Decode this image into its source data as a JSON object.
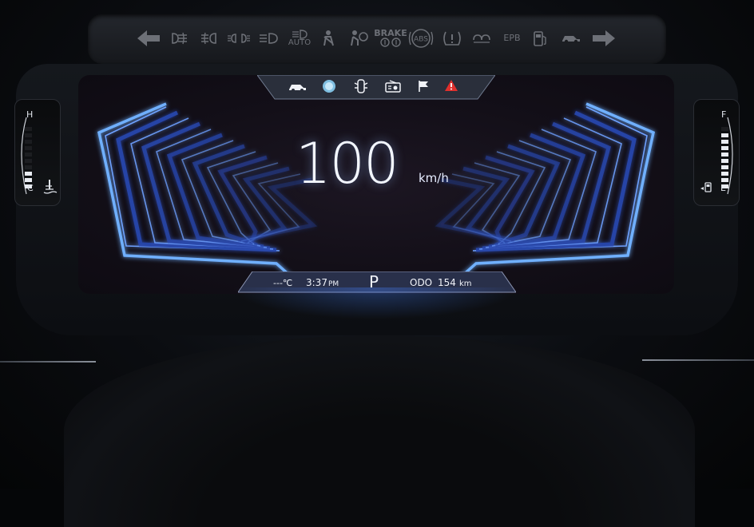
{
  "telltales": {
    "items": [
      {
        "name": "turn-left-icon"
      },
      {
        "name": "rear-fog-icon"
      },
      {
        "name": "front-fog-icon"
      },
      {
        "name": "position-lamp-icon"
      },
      {
        "name": "high-beam-icon"
      },
      {
        "name": "auto-headlamp-icon",
        "label": "AUTO"
      },
      {
        "name": "seatbelt-icon"
      },
      {
        "name": "airbag-icon"
      },
      {
        "name": "brake-warning-icon",
        "label": "BRAKE"
      },
      {
        "name": "abs-icon",
        "label": "ABS"
      },
      {
        "name": "tire-pressure-icon"
      },
      {
        "name": "glow-plug-icon"
      },
      {
        "name": "epb-icon",
        "label": "EPB"
      },
      {
        "name": "fuel-warning-icon"
      },
      {
        "name": "car-key-icon"
      },
      {
        "name": "turn-right-icon"
      }
    ]
  },
  "screen_topbar": {
    "icons": [
      "car-icon",
      "driver-assist-icon",
      "door-icon",
      "radio-icon",
      "flag-icon",
      "warning-triangle-icon"
    ]
  },
  "speedometer": {
    "value": "100",
    "unit": "km/h"
  },
  "status_bar": {
    "temperature": "---℃",
    "time": "3:37",
    "ampm": "PM",
    "gear": "P",
    "odo_label": "ODO",
    "odo_value": "154",
    "odo_unit": "km"
  },
  "coolant_gauge": {
    "high_label": "H",
    "low_label": "C",
    "level_fraction": 0.33
  },
  "fuel_gauge": {
    "full_label": "F",
    "empty_label": "E",
    "level_fraction": 0.9
  },
  "colors": {
    "accent_blue": "#3d7bff",
    "glow_blue": "#78b4ff",
    "warning_red": "#e0302d",
    "telltale_grey": "#6d7077"
  }
}
